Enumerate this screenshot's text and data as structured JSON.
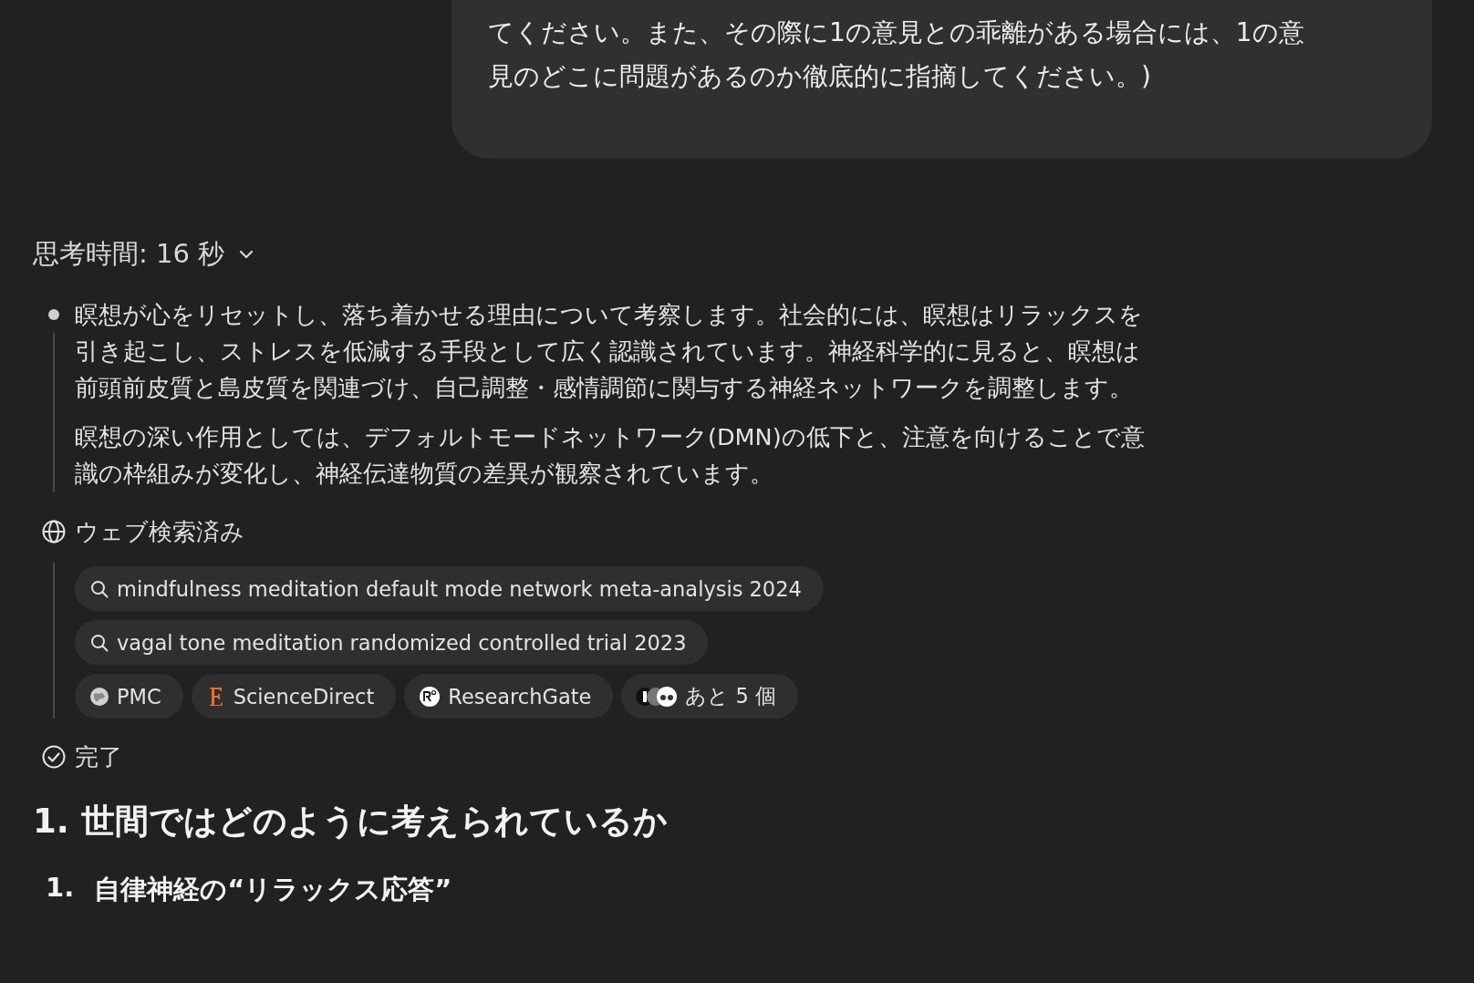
{
  "user_message": {
    "lines": [
      "てください。また、その際に1の意見との乖離がある場合には、1の意",
      "見のどこに問題があるのか徹底的に指摘してください。)"
    ]
  },
  "thinking": {
    "label": "思考時間: 16 秒",
    "expanded": true,
    "paragraphs": [
      "瞑想が心をリセットし、落ち着かせる理由について考察します。社会的には、瞑想はリラックスを引き起こし、ストレスを低減する手段として広く認識されています。神経科学的に見ると、瞑想は前頭前皮質と島皮質を関連づけ、自己調整・感情調節に関与する神経ネットワークを調整します。",
      "瞑想の深い作用としては、デフォルトモードネットワーク(DMN)の低下と、注意を向けることで意識の枠組みが変化し、神経伝達物質の差異が観察されています。"
    ],
    "web_search": {
      "label": "ウェブ検索済み",
      "queries": [
        "mindfulness meditation default mode network meta-analysis 2024",
        "vagal tone meditation randomized controlled trial 2023"
      ],
      "sources": [
        {
          "kind": "site",
          "label": "PMC"
        },
        {
          "kind": "site",
          "label": "ScienceDirect"
        },
        {
          "kind": "site",
          "label": "ResearchGate"
        },
        {
          "kind": "more",
          "label": "あと 5 個"
        }
      ]
    },
    "done_label": "完了"
  },
  "answer": {
    "heading": "1. 世間ではどのように考えられているか",
    "items": [
      {
        "number": "1.",
        "title": "自律神経の“リラックス応答”"
      }
    ]
  }
}
